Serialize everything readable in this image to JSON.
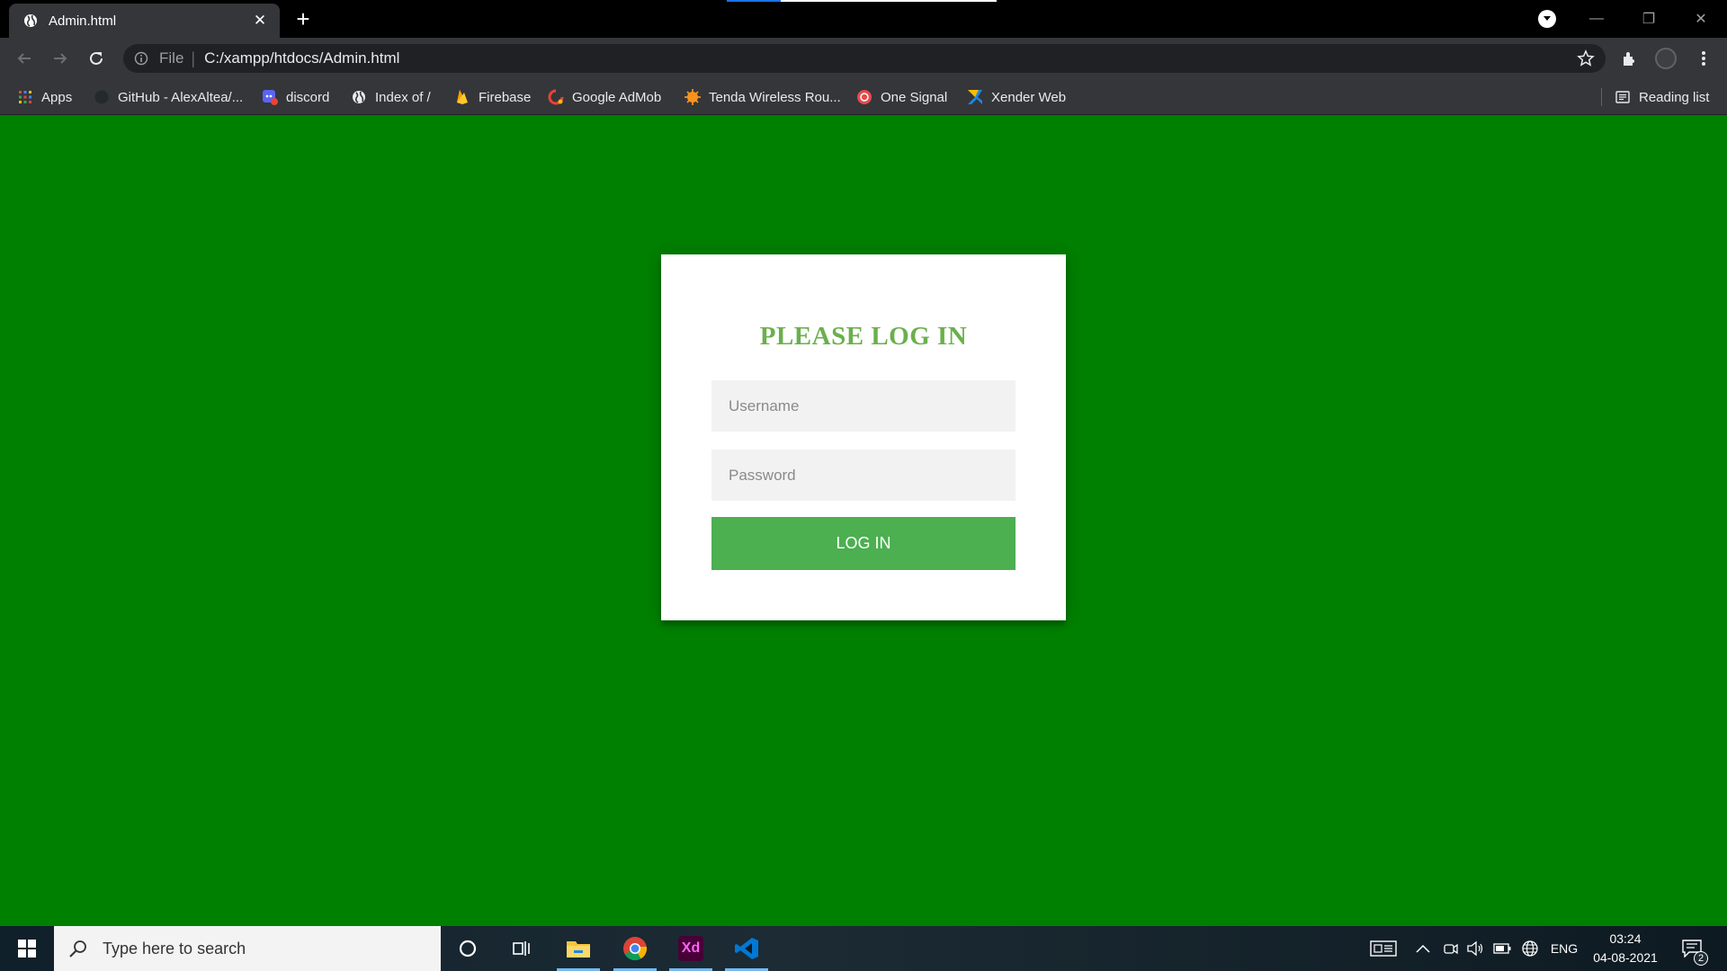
{
  "browser": {
    "tab": {
      "title": "Admin.html",
      "close_glyph": "✕"
    },
    "new_tab_glyph": "+",
    "window_controls": {
      "minimize": "—",
      "restore": "❐",
      "close": "✕"
    },
    "address": {
      "scheme": "File",
      "separator": "|",
      "url": "C:/xampp/htdocs/Admin.html"
    },
    "bookmarks": [
      {
        "label": "Apps",
        "icon": "apps-grid-icon"
      },
      {
        "label": "GitHub - AlexAltea/...",
        "icon": "github-icon"
      },
      {
        "label": "discord",
        "icon": "discord-icon"
      },
      {
        "label": "Index of /",
        "icon": "globe-icon"
      },
      {
        "label": "Firebase",
        "icon": "firebase-icon"
      },
      {
        "label": "Google AdMob",
        "icon": "admob-icon"
      },
      {
        "label": "Tenda Wireless Rou...",
        "icon": "tenda-icon"
      },
      {
        "label": "One Signal",
        "icon": "onesignal-icon"
      },
      {
        "label": "Xender Web",
        "icon": "xender-icon"
      }
    ],
    "reading_list": {
      "label": "Reading list",
      "icon": "reading-list-icon"
    }
  },
  "page": {
    "background": "#008000",
    "title": "PLEASE LOG IN",
    "username_placeholder": "Username",
    "password_placeholder": "Password",
    "login_button": "LOG IN",
    "accent_title_color": "#6ab04c",
    "button_color": "#4caf50"
  },
  "taskbar": {
    "search_placeholder": "Type here to search",
    "apps": [
      "cortana-icon",
      "task-view-icon",
      "file-explorer-icon",
      "chrome-icon",
      "adobe-xd-icon",
      "vscode-icon"
    ],
    "xd_label": "Xd",
    "language": "ENG",
    "time": "03:24",
    "date": "04-08-2021",
    "notification_count": "2"
  }
}
